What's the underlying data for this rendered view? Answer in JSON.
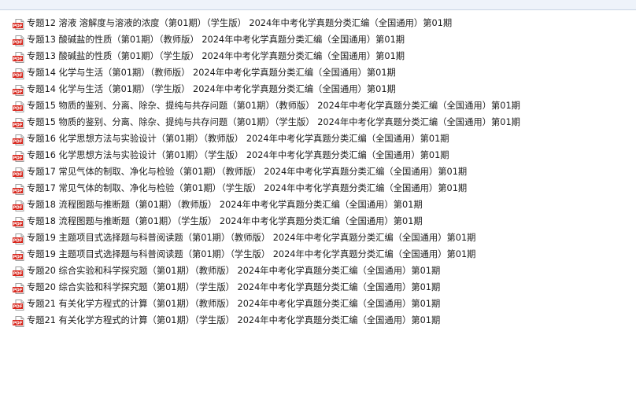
{
  "files": [
    {
      "name": "专题12 溶液 溶解度与溶液的浓度（第01期）（学生版） 2024年中考化学真题分类汇编（全国通用）第01期",
      "icon": "pdf-icon"
    },
    {
      "name": "专题13 酸碱盐的性质（第01期）（教师版） 2024年中考化学真题分类汇编（全国通用）第01期",
      "icon": "pdf-icon"
    },
    {
      "name": "专题13 酸碱盐的性质（第01期）（学生版） 2024年中考化学真题分类汇编（全国通用）第01期",
      "icon": "pdf-icon"
    },
    {
      "name": "专题14 化学与生活（第01期）（教师版） 2024年中考化学真题分类汇编（全国通用）第01期",
      "icon": "pdf-icon"
    },
    {
      "name": "专题14 化学与生活（第01期）（学生版） 2024年中考化学真题分类汇编（全国通用）第01期",
      "icon": "pdf-icon"
    },
    {
      "name": "专题15 物质的鉴别、分离、除杂、提纯与共存问题（第01期）（教师版） 2024年中考化学真题分类汇编（全国通用）第01期",
      "icon": "pdf-icon"
    },
    {
      "name": "专题15 物质的鉴别、分离、除杂、提纯与共存问题（第01期）（学生版） 2024年中考化学真题分类汇编（全国通用）第01期",
      "icon": "pdf-icon"
    },
    {
      "name": "专题16 化学思想方法与实验设计（第01期）（教师版） 2024年中考化学真题分类汇编（全国通用）第01期",
      "icon": "pdf-icon"
    },
    {
      "name": "专题16 化学思想方法与实验设计（第01期）（学生版） 2024年中考化学真题分类汇编（全国通用）第01期",
      "icon": "pdf-icon"
    },
    {
      "name": "专题17 常见气体的制取、净化与检验（第01期）（教师版） 2024年中考化学真题分类汇编（全国通用）第01期",
      "icon": "pdf-icon"
    },
    {
      "name": "专题17 常见气体的制取、净化与检验（第01期）（学生版） 2024年中考化学真题分类汇编（全国通用）第01期",
      "icon": "pdf-icon"
    },
    {
      "name": "专题18 流程图题与推断题（第01期）（教师版） 2024年中考化学真题分类汇编（全国通用）第01期",
      "icon": "pdf-icon"
    },
    {
      "name": "专题18 流程图题与推断题（第01期）（学生版） 2024年中考化学真题分类汇编（全国通用）第01期",
      "icon": "pdf-icon"
    },
    {
      "name": "专题19 主题项目式选择题与科普阅读题（第01期）（教师版） 2024年中考化学真题分类汇编（全国通用）第01期",
      "icon": "pdf-icon"
    },
    {
      "name": "专题19 主题项目式选择题与科普阅读题（第01期）（学生版） 2024年中考化学真题分类汇编（全国通用）第01期",
      "icon": "pdf-icon"
    },
    {
      "name": "专题20 综合实验和科学探究题（第01期）（教师版） 2024年中考化学真题分类汇编（全国通用）第01期",
      "icon": "pdf-icon"
    },
    {
      "name": "专题20 综合实验和科学探究题（第01期）（学生版） 2024年中考化学真题分类汇编（全国通用）第01期",
      "icon": "pdf-icon"
    },
    {
      "name": "专题21 有关化学方程式的计算（第01期）（教师版） 2024年中考化学真题分类汇编（全国通用）第01期",
      "icon": "pdf-icon"
    },
    {
      "name": "专题21 有关化学方程式的计算（第01期）（学生版） 2024年中考化学真题分类汇编（全国通用）第01期",
      "icon": "pdf-icon"
    }
  ],
  "icon_label": "PDF",
  "colors": {
    "icon_red": "#d8261c",
    "text": "#1a1a1a",
    "topbar": "#eef3fa"
  }
}
